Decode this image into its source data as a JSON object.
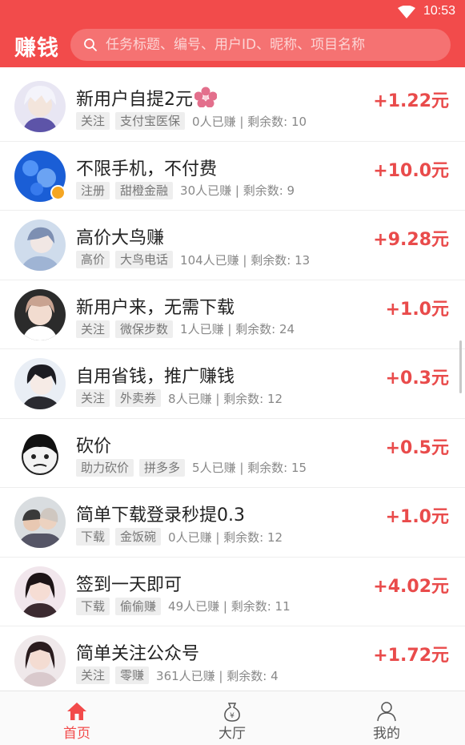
{
  "status_bar": {
    "time": "10:53"
  },
  "app_bar": {
    "title": "赚钱",
    "search_placeholder": "任务标题、编号、用户ID、昵称、项目名称"
  },
  "tasks": [
    {
      "title": "新用户自提2元",
      "tag1": "关注",
      "tag2": "支付宝医保",
      "stats": "0人已赚 | 剩余数: 10",
      "reward": "+1.22元"
    },
    {
      "title": "不限手机，不付费",
      "tag1": "注册",
      "tag2": "甜橙金融",
      "stats": "30人已赚 | 剩余数: 9",
      "reward": "+10.0元"
    },
    {
      "title": "高价大鸟赚",
      "tag1": "高价",
      "tag2": "大鸟电话",
      "stats": "104人已赚 | 剩余数: 13",
      "reward": "+9.28元"
    },
    {
      "title": "新用户来，无需下载",
      "tag1": "关注",
      "tag2": "微保步数",
      "stats": "1人已赚 | 剩余数: 24",
      "reward": "+1.0元"
    },
    {
      "title": "自用省钱，推广赚钱",
      "tag1": "关注",
      "tag2": "外卖券",
      "stats": "8人已赚 | 剩余数: 12",
      "reward": "+0.3元"
    },
    {
      "title": "砍价",
      "tag1": "助力砍价",
      "tag2": "拼多多",
      "stats": "5人已赚 | 剩余数: 15",
      "reward": "+0.5元"
    },
    {
      "title": "简单下载登录秒提0.3",
      "tag1": "下载",
      "tag2": "金饭碗",
      "stats": "0人已赚 | 剩余数: 12",
      "reward": "+1.0元"
    },
    {
      "title": "签到一天即可",
      "tag1": "下载",
      "tag2": "偷偷赚",
      "stats": "49人已赚 | 剩余数: 11",
      "reward": "+4.02元"
    },
    {
      "title": "简单关注公众号",
      "tag1": "关注",
      "tag2": "零赚",
      "stats": "361人已赚 | 剩余数: 4",
      "reward": "+1.72元"
    }
  ],
  "bottom_nav": [
    {
      "label": "首页",
      "icon": "home-icon",
      "active": true
    },
    {
      "label": "大厅",
      "icon": "money-bag-icon",
      "active": false
    },
    {
      "label": "我的",
      "icon": "person-icon",
      "active": false
    }
  ],
  "colors": {
    "primary": "#f24b4b",
    "reward": "#e94b4b",
    "tag_bg": "#eeeeee"
  }
}
